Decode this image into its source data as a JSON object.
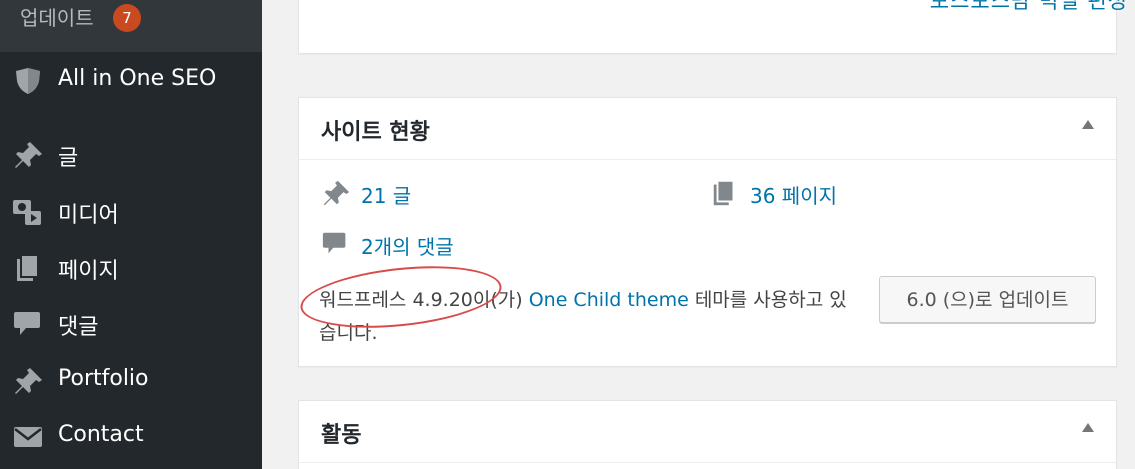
{
  "sidebar": {
    "updates": {
      "label": "업데이트",
      "count": "7"
    },
    "items": [
      {
        "label": "All in One SEO",
        "icon": "shield-icon"
      },
      {
        "label": "글",
        "icon": "pushpin-icon"
      },
      {
        "label": "미디어",
        "icon": "media-icon"
      },
      {
        "label": "페이지",
        "icon": "pages-icon"
      },
      {
        "label": "댓글",
        "icon": "comment-icon"
      },
      {
        "label": "Portfolio",
        "icon": "pushpin-icon"
      },
      {
        "label": "Contact",
        "icon": "envelope-icon"
      }
    ]
  },
  "top_card": {
    "link_partial": "보스보스팜 빅얼 편성"
  },
  "glance": {
    "title": "사이트 현황",
    "posts": "21 글",
    "pages": "36 페이지",
    "comments": "2개의 댓글",
    "wp_prefix": "워드프레스 4.9.20이(가) ",
    "theme": "One Child theme",
    "wp_suffix": " 테마를 사용하고 있습니다.",
    "update_button": "6.0 (으)로 업데이트"
  },
  "activity": {
    "title": "활동"
  },
  "colors": {
    "sidebar": "#23282d",
    "link": "#0073aa",
    "badge": "#ca4a1f",
    "annotation": "#d94b4b"
  }
}
